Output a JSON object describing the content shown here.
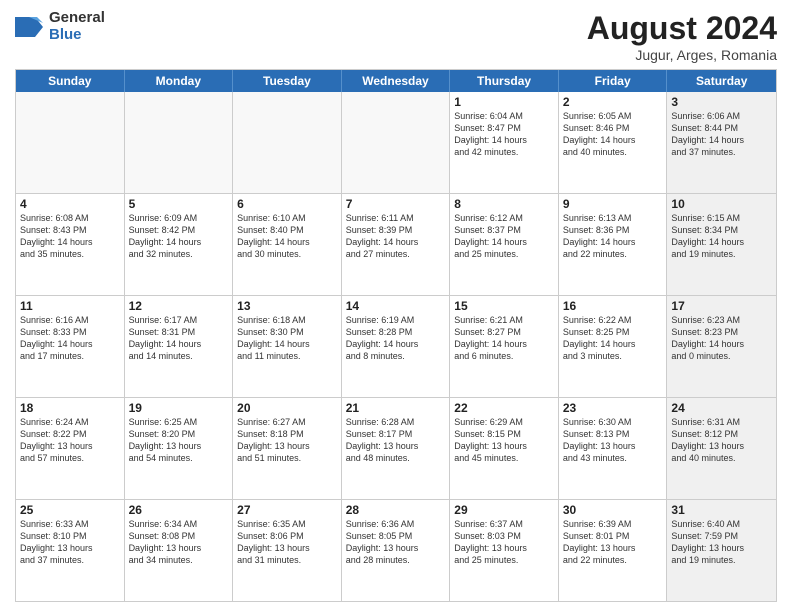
{
  "header": {
    "logo_line1": "General",
    "logo_line2": "Blue",
    "month_year": "August 2024",
    "location": "Jugur, Arges, Romania"
  },
  "weekdays": [
    "Sunday",
    "Monday",
    "Tuesday",
    "Wednesday",
    "Thursday",
    "Friday",
    "Saturday"
  ],
  "rows": [
    [
      {
        "day": "",
        "text": "",
        "empty": true
      },
      {
        "day": "",
        "text": "",
        "empty": true
      },
      {
        "day": "",
        "text": "",
        "empty": true
      },
      {
        "day": "",
        "text": "",
        "empty": true
      },
      {
        "day": "1",
        "text": "Sunrise: 6:04 AM\nSunset: 8:47 PM\nDaylight: 14 hours\nand 42 minutes."
      },
      {
        "day": "2",
        "text": "Sunrise: 6:05 AM\nSunset: 8:46 PM\nDaylight: 14 hours\nand 40 minutes."
      },
      {
        "day": "3",
        "text": "Sunrise: 6:06 AM\nSunset: 8:44 PM\nDaylight: 14 hours\nand 37 minutes.",
        "shaded": true
      }
    ],
    [
      {
        "day": "4",
        "text": "Sunrise: 6:08 AM\nSunset: 8:43 PM\nDaylight: 14 hours\nand 35 minutes."
      },
      {
        "day": "5",
        "text": "Sunrise: 6:09 AM\nSunset: 8:42 PM\nDaylight: 14 hours\nand 32 minutes."
      },
      {
        "day": "6",
        "text": "Sunrise: 6:10 AM\nSunset: 8:40 PM\nDaylight: 14 hours\nand 30 minutes."
      },
      {
        "day": "7",
        "text": "Sunrise: 6:11 AM\nSunset: 8:39 PM\nDaylight: 14 hours\nand 27 minutes."
      },
      {
        "day": "8",
        "text": "Sunrise: 6:12 AM\nSunset: 8:37 PM\nDaylight: 14 hours\nand 25 minutes."
      },
      {
        "day": "9",
        "text": "Sunrise: 6:13 AM\nSunset: 8:36 PM\nDaylight: 14 hours\nand 22 minutes."
      },
      {
        "day": "10",
        "text": "Sunrise: 6:15 AM\nSunset: 8:34 PM\nDaylight: 14 hours\nand 19 minutes.",
        "shaded": true
      }
    ],
    [
      {
        "day": "11",
        "text": "Sunrise: 6:16 AM\nSunset: 8:33 PM\nDaylight: 14 hours\nand 17 minutes."
      },
      {
        "day": "12",
        "text": "Sunrise: 6:17 AM\nSunset: 8:31 PM\nDaylight: 14 hours\nand 14 minutes."
      },
      {
        "day": "13",
        "text": "Sunrise: 6:18 AM\nSunset: 8:30 PM\nDaylight: 14 hours\nand 11 minutes."
      },
      {
        "day": "14",
        "text": "Sunrise: 6:19 AM\nSunset: 8:28 PM\nDaylight: 14 hours\nand 8 minutes."
      },
      {
        "day": "15",
        "text": "Sunrise: 6:21 AM\nSunset: 8:27 PM\nDaylight: 14 hours\nand 6 minutes."
      },
      {
        "day": "16",
        "text": "Sunrise: 6:22 AM\nSunset: 8:25 PM\nDaylight: 14 hours\nand 3 minutes."
      },
      {
        "day": "17",
        "text": "Sunrise: 6:23 AM\nSunset: 8:23 PM\nDaylight: 14 hours\nand 0 minutes.",
        "shaded": true
      }
    ],
    [
      {
        "day": "18",
        "text": "Sunrise: 6:24 AM\nSunset: 8:22 PM\nDaylight: 13 hours\nand 57 minutes."
      },
      {
        "day": "19",
        "text": "Sunrise: 6:25 AM\nSunset: 8:20 PM\nDaylight: 13 hours\nand 54 minutes."
      },
      {
        "day": "20",
        "text": "Sunrise: 6:27 AM\nSunset: 8:18 PM\nDaylight: 13 hours\nand 51 minutes."
      },
      {
        "day": "21",
        "text": "Sunrise: 6:28 AM\nSunset: 8:17 PM\nDaylight: 13 hours\nand 48 minutes."
      },
      {
        "day": "22",
        "text": "Sunrise: 6:29 AM\nSunset: 8:15 PM\nDaylight: 13 hours\nand 45 minutes."
      },
      {
        "day": "23",
        "text": "Sunrise: 6:30 AM\nSunset: 8:13 PM\nDaylight: 13 hours\nand 43 minutes."
      },
      {
        "day": "24",
        "text": "Sunrise: 6:31 AM\nSunset: 8:12 PM\nDaylight: 13 hours\nand 40 minutes.",
        "shaded": true
      }
    ],
    [
      {
        "day": "25",
        "text": "Sunrise: 6:33 AM\nSunset: 8:10 PM\nDaylight: 13 hours\nand 37 minutes."
      },
      {
        "day": "26",
        "text": "Sunrise: 6:34 AM\nSunset: 8:08 PM\nDaylight: 13 hours\nand 34 minutes."
      },
      {
        "day": "27",
        "text": "Sunrise: 6:35 AM\nSunset: 8:06 PM\nDaylight: 13 hours\nand 31 minutes."
      },
      {
        "day": "28",
        "text": "Sunrise: 6:36 AM\nSunset: 8:05 PM\nDaylight: 13 hours\nand 28 minutes."
      },
      {
        "day": "29",
        "text": "Sunrise: 6:37 AM\nSunset: 8:03 PM\nDaylight: 13 hours\nand 25 minutes."
      },
      {
        "day": "30",
        "text": "Sunrise: 6:39 AM\nSunset: 8:01 PM\nDaylight: 13 hours\nand 22 minutes."
      },
      {
        "day": "31",
        "text": "Sunrise: 6:40 AM\nSunset: 7:59 PM\nDaylight: 13 hours\nand 19 minutes.",
        "shaded": true
      }
    ]
  ]
}
